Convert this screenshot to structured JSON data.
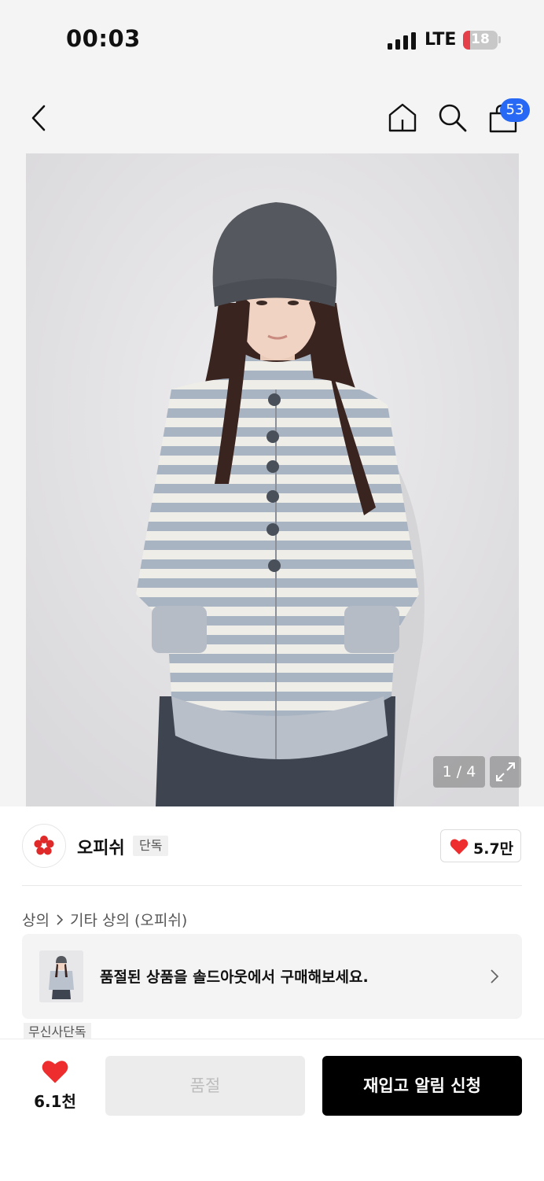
{
  "status_bar": {
    "time": "00:03",
    "network": "LTE",
    "battery": "18"
  },
  "nav": {
    "cart_count": "53"
  },
  "gallery": {
    "counter": "1 / 4"
  },
  "brand": {
    "name": "오피쉬",
    "tag": "단독",
    "likes": "5.7만"
  },
  "breadcrumb": {
    "level1": "상의",
    "level2": "기타 상의 (오피쉬)"
  },
  "soldout_banner": {
    "text": "품절된 상품을 솔드아웃에서 구매해보세요."
  },
  "exclusive_tag": "무신사단독",
  "bottom_bar": {
    "like_count": "6.1천",
    "soldout_label": "품절",
    "restock_label": "재입고 알림 신청"
  },
  "colors": {
    "accent_red": "#ee2e2e",
    "badge_blue": "#2769f5",
    "primary_black": "#000000"
  }
}
